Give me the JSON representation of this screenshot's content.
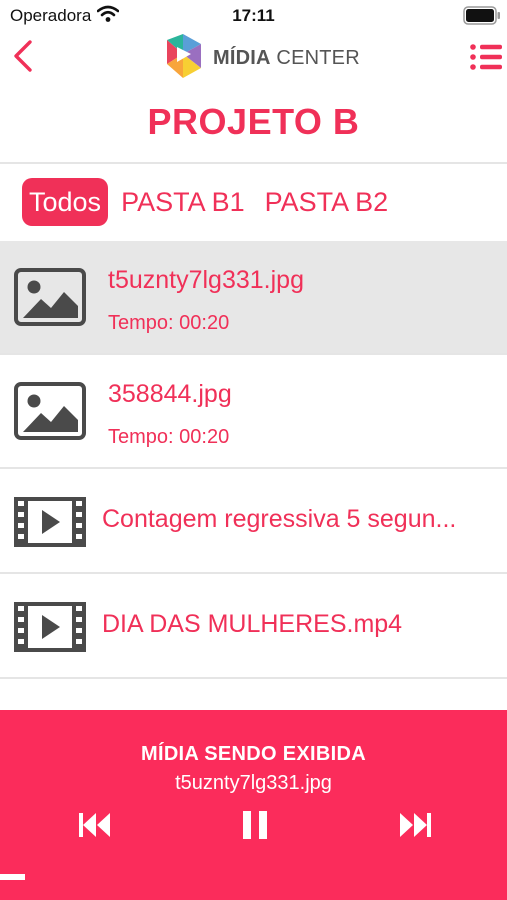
{
  "status_bar": {
    "carrier": "Operadora",
    "time": "17:11"
  },
  "nav": {
    "logo_text_bold": "MÍDIA",
    "logo_text_light": " CENTER"
  },
  "page_title": "PROJETO B",
  "tabs": [
    {
      "label": "Todos",
      "active": true
    },
    {
      "label": "PASTA B1",
      "active": false
    },
    {
      "label": "PASTA B2",
      "active": false
    }
  ],
  "media_items": [
    {
      "type": "image",
      "title": "t5uznty7lg331.jpg",
      "subtitle": "Tempo: 00:20",
      "selected": true
    },
    {
      "type": "image",
      "title": "358844.jpg",
      "subtitle": "Tempo: 00:20",
      "selected": false
    },
    {
      "type": "video",
      "title": "Contagem regressiva 5 segun...",
      "selected": false
    },
    {
      "type": "video",
      "title": "DIA DAS MULHERES.mp4",
      "selected": false
    }
  ],
  "player": {
    "label": "MÍDIA SENDO EXIBIDA",
    "filename": "t5uznty7lg331.jpg",
    "progress_fraction": 0.05
  },
  "colors": {
    "accent": "#f03058",
    "player_background": "#fb2c5b",
    "icon_gray": "#4a4a4a",
    "selected_row": "#e7e7e7"
  },
  "icons": {
    "back": "chevron-left-icon",
    "menu": "list-menu-icon",
    "image_item": "image-icon",
    "video_item": "film-play-icon",
    "prev": "skip-previous-icon",
    "pause": "pause-icon",
    "next": "skip-next-icon"
  }
}
